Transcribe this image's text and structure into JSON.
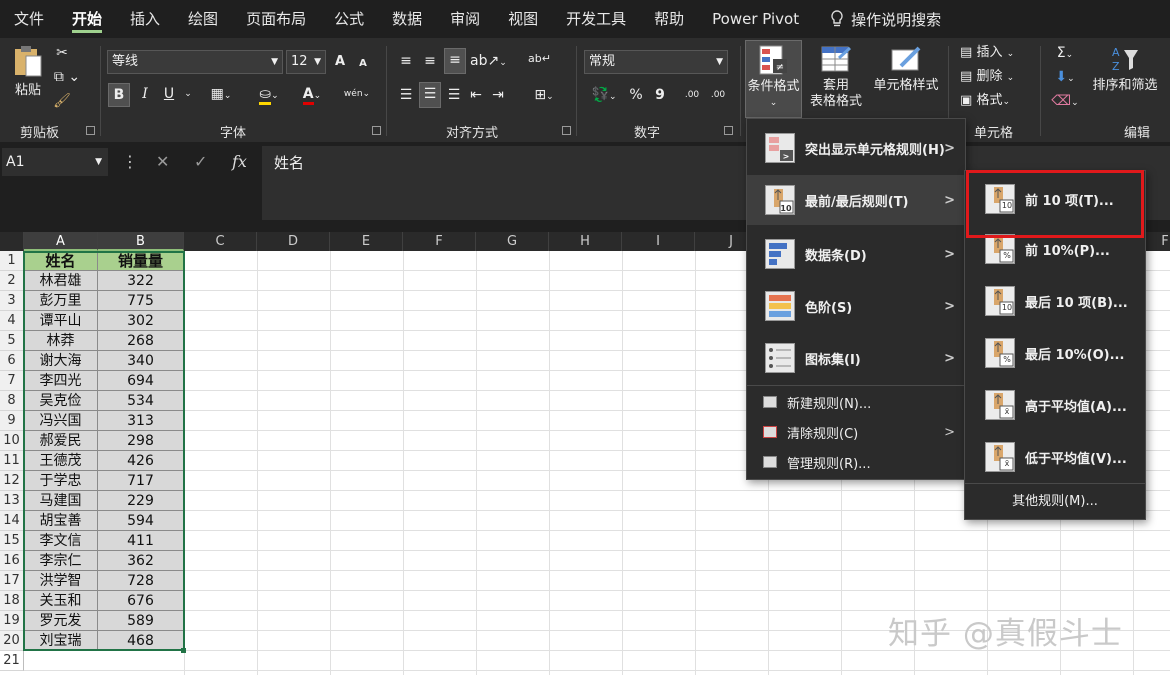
{
  "menubar": {
    "tabs": [
      "文件",
      "开始",
      "插入",
      "绘图",
      "页面布局",
      "公式",
      "数据",
      "审阅",
      "视图",
      "开发工具",
      "帮助",
      "Power Pivot"
    ],
    "active_tab": "开始",
    "tell_me": "操作说明搜索"
  },
  "ribbon": {
    "groups": {
      "clipboard": "剪贴板",
      "font": "字体",
      "alignment": "对齐方式",
      "number": "数字",
      "cells": "单元格",
      "editing": "编辑"
    },
    "paste_label": "粘贴",
    "font_name": "等线",
    "font_size": "12",
    "number_format": "常规",
    "conditional_format": "条件格式",
    "format_as_table_1": "套用",
    "format_as_table_2": "表格格式",
    "cell_styles": "单元格样式",
    "insert": "插入",
    "delete": "删除",
    "format": "格式",
    "sort_filter": "排序和筛选",
    "bold": "B",
    "italic": "I",
    "underline": "U",
    "font_color_letter": "A",
    "percent": "%",
    "comma": "9",
    "inc_decimal": ".00",
    "dec_decimal": ".00",
    "grow": "A",
    "shrink": "A",
    "wen": "wén"
  },
  "formula_bar": {
    "name_box": "A1",
    "content": "姓名",
    "fx": "fx"
  },
  "sheet": {
    "columns": [
      "A",
      "B",
      "C",
      "D",
      "E",
      "F",
      "G",
      "H",
      "I",
      "J"
    ],
    "last_col_partial": "F",
    "header": [
      "姓名",
      "销量量"
    ],
    "rows": [
      [
        "林君雄",
        "322"
      ],
      [
        "彭万里",
        "775"
      ],
      [
        "谭平山",
        "302"
      ],
      [
        "林莽",
        "268"
      ],
      [
        "谢大海",
        "340"
      ],
      [
        "李四光",
        "694"
      ],
      [
        "吴克俭",
        "534"
      ],
      [
        "冯兴国",
        "313"
      ],
      [
        "郝爱民",
        "298"
      ],
      [
        "王德茂",
        "426"
      ],
      [
        "于学忠",
        "717"
      ],
      [
        "马建国",
        "229"
      ],
      [
        "胡宝善",
        "594"
      ],
      [
        "李文信",
        "411"
      ],
      [
        "李宗仁",
        "362"
      ],
      [
        "洪学智",
        "728"
      ],
      [
        "关玉和",
        "676"
      ],
      [
        "罗元发",
        "589"
      ],
      [
        "刘宝瑞",
        "468"
      ]
    ],
    "row_numbers": [
      "1",
      "2",
      "3",
      "4",
      "5",
      "6",
      "7",
      "8",
      "9",
      "10",
      "11",
      "12",
      "13",
      "14",
      "15",
      "16",
      "17",
      "18",
      "19",
      "20",
      "21"
    ]
  },
  "cf_menu": {
    "items": [
      "突出显示单元格规则(H)",
      "最前/最后规则(T)",
      "数据条(D)",
      "色阶(S)",
      "图标集(I)"
    ],
    "small_items": [
      "新建规则(N)...",
      "清除规则(C)",
      "管理规则(R)..."
    ]
  },
  "topbottom_menu": {
    "items": [
      "前 10 项(T)...",
      "前 10%(P)...",
      "最后 10 项(B)...",
      "最后 10%(O)...",
      "高于平均值(A)...",
      "低于平均值(V)..."
    ],
    "more": "其他规则(M)...",
    "icon_tags": [
      "10",
      "%",
      "10",
      "%",
      "x̄",
      "x̄"
    ]
  },
  "watermark": "知乎 @真假斗士",
  "colors": {
    "header_green": "#a9d08e",
    "data_gray": "#d8d8d8",
    "highlight_red": "#e0191b",
    "ribbon_bg": "#2d2d2d"
  }
}
